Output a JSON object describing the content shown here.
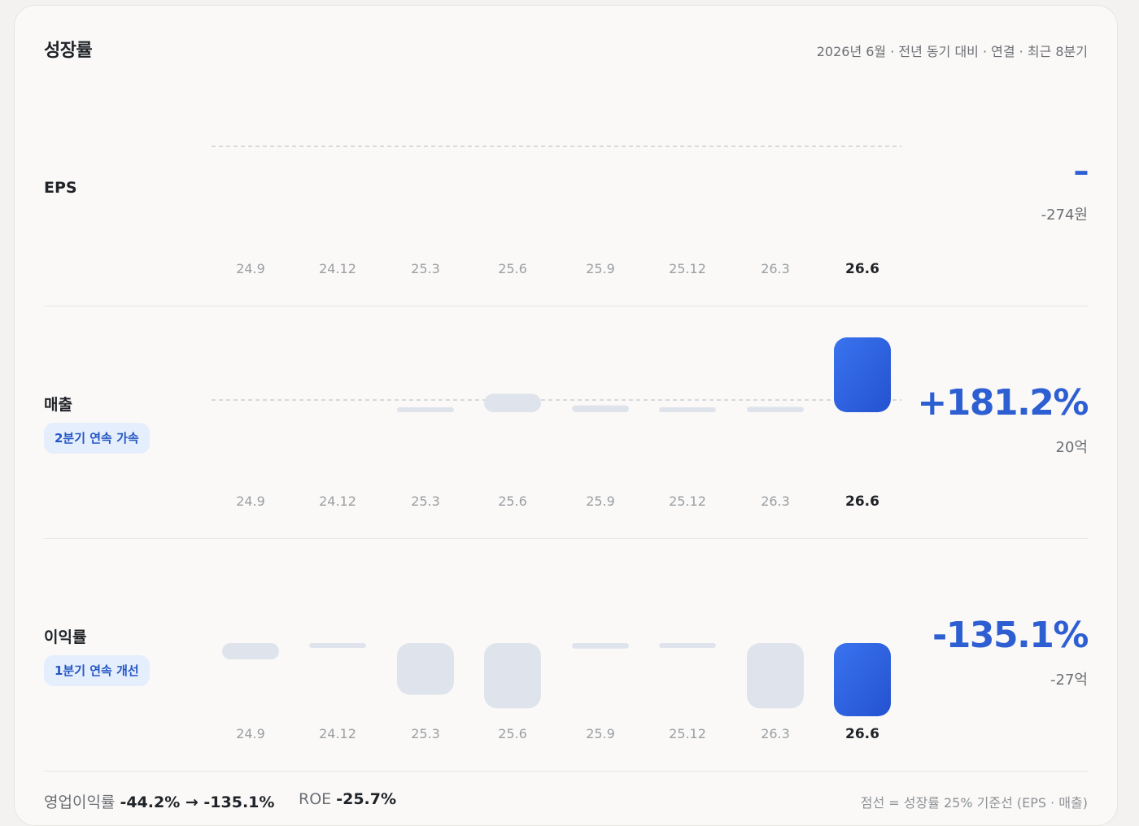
{
  "header": {
    "title": "성장률",
    "subtitle": "2026년 6월 · 전년 동기 대비 · 연결 · 최근 8분기"
  },
  "colors": {
    "accent": "#2d5fd3",
    "accent_gradient": [
      "#3a73ef",
      "#2452d0"
    ],
    "muted_bar": "#dfe4ec",
    "reference_line": "#c3c6cb"
  },
  "chart_data": [
    {
      "type": "bar",
      "name": "EPS",
      "categories": [
        "24.9",
        "24.12",
        "25.3",
        "25.6",
        "25.9",
        "25.12",
        "26.3",
        "26.6"
      ],
      "values": [
        null,
        null,
        null,
        null,
        null,
        null,
        null,
        null
      ],
      "reference_line": 25,
      "highlight_index": 7,
      "latest_growth": "–",
      "latest_value": "-274원"
    },
    {
      "type": "bar",
      "name": "매출",
      "categories": [
        "24.9",
        "24.12",
        "25.3",
        "25.6",
        "25.9",
        "25.12",
        "26.3",
        "26.6"
      ],
      "values": [
        null,
        null,
        1,
        38,
        14,
        8,
        11,
        181.2
      ],
      "reference_line": 25,
      "highlight_index": 7,
      "badge": "2분기 연속 가속",
      "latest_growth": "+181.2%",
      "latest_value": "20억"
    },
    {
      "type": "bar",
      "name": "이익률",
      "categories": [
        "24.9",
        "24.12",
        "25.3",
        "25.6",
        "25.9",
        "25.12",
        "26.3",
        "26.6"
      ],
      "values": [
        -30,
        -8,
        -95,
        -120,
        -10,
        -8,
        -120,
        -135.1
      ],
      "highlight_index": 7,
      "badge": "1분기 연속 개선",
      "latest_growth": "-135.1%",
      "latest_value": "-27억"
    }
  ],
  "footer": {
    "op_margin_label": "영업이익률",
    "op_margin_value": "-44.2% → -135.1%",
    "roe_label": "ROE",
    "roe_value": "-25.7%",
    "note": "점선 = 성장률 25% 기준선 (EPS · 매출)"
  }
}
